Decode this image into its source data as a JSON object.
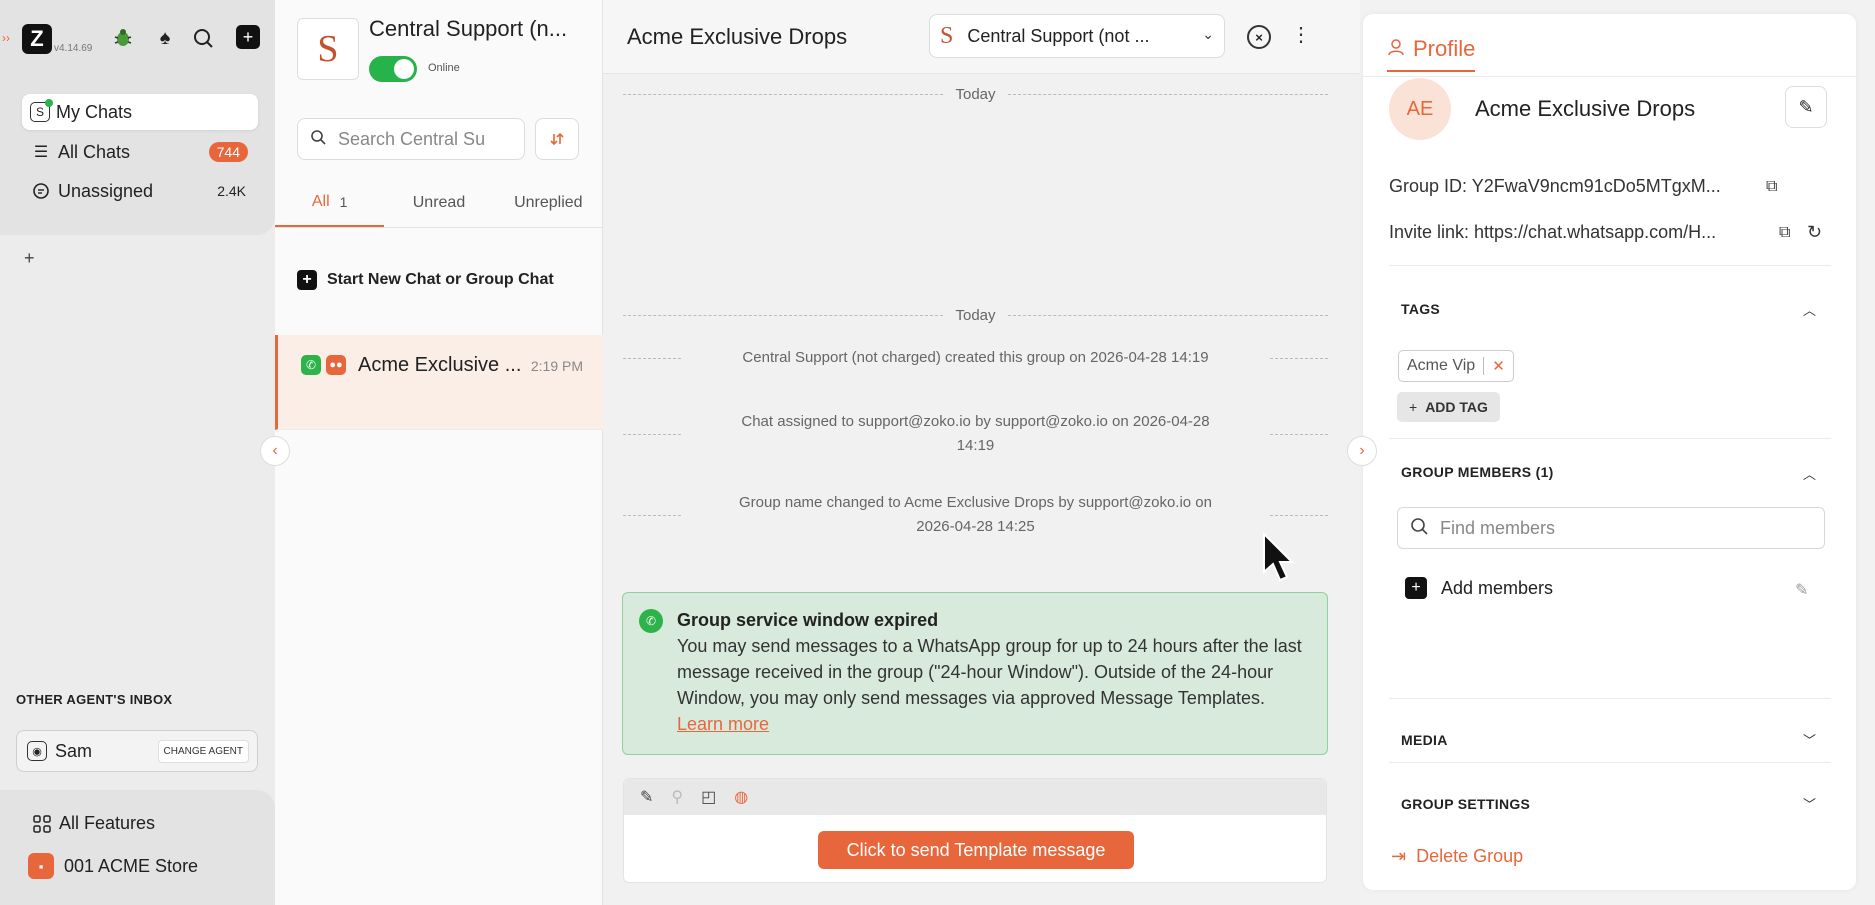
{
  "app": {
    "version": "v4.14.69",
    "accent_color": "#e8663b",
    "online_color": "#26b34a"
  },
  "nav": {
    "icons": [
      "bug-icon",
      "spade-icon",
      "search-icon",
      "new-item-icon"
    ],
    "items": [
      {
        "label": "My Chats",
        "count": ""
      },
      {
        "label": "All Chats",
        "count": "744"
      },
      {
        "label": "Unassigned",
        "count": "2.4K"
      }
    ],
    "add_label": "+",
    "other_inbox_title": "OTHER AGENT'S INBOX",
    "agent_name": "Sam",
    "change_agent_label": "CHANGE AGENT",
    "all_features_label": "All Features",
    "store_label": "001 ACME Store"
  },
  "inbox": {
    "avatar_letter": "S",
    "name": "Central Support (n...",
    "status": "Online",
    "search_placeholder": "Search Central Su",
    "tabs": [
      {
        "label": "All",
        "count": "1"
      },
      {
        "label": "Unread",
        "count": ""
      },
      {
        "label": "Unreplied",
        "count": ""
      }
    ],
    "new_chat_label": "Start New Chat or Group Chat",
    "chats": [
      {
        "name": "Acme Exclusive ...",
        "time": "2:19 PM"
      }
    ]
  },
  "conversation": {
    "title": "Acme Exclusive Drops",
    "assignee_letter": "S",
    "assignee": "Central Support (not ...",
    "day_label_top": "Today",
    "day_label": "Today",
    "system_messages": [
      "Central Support (not charged) created this group on 2026-04-28 14:19",
      "Chat assigned to support@zoko.io by support@zoko.io on 2026-04-28 14:19",
      "Group name changed to Acme Exclusive Drops by support@zoko.io on 2026-04-28 14:25"
    ],
    "expired_title": "Group service window expired",
    "expired_body": "You may send messages to a WhatsApp group for up to 24 hours after the last message received in the group (\"24-hour Window\"). Outside of the 24-hour Window, you may only send messages via approved Message Templates. ",
    "learn_more": "Learn more",
    "template_button": "Click to send Template message"
  },
  "profile": {
    "tab_label": "Profile",
    "initials": "AE",
    "name": "Acme Exclusive Drops",
    "group_id": "Group ID: Y2FwaV9ncm91cDo5MTgxM...",
    "invite_link": "Invite link: https://chat.whatsapp.com/H...",
    "tags_title": "TAGS",
    "tags": [
      "Acme Vip"
    ],
    "add_tag_label": "ADD TAG",
    "members_title": "GROUP MEMBERS (1)",
    "find_members_placeholder": "Find members",
    "add_members_label": "Add members",
    "media_title": "MEDIA",
    "settings_title": "GROUP SETTINGS",
    "delete_label": "Delete Group"
  }
}
